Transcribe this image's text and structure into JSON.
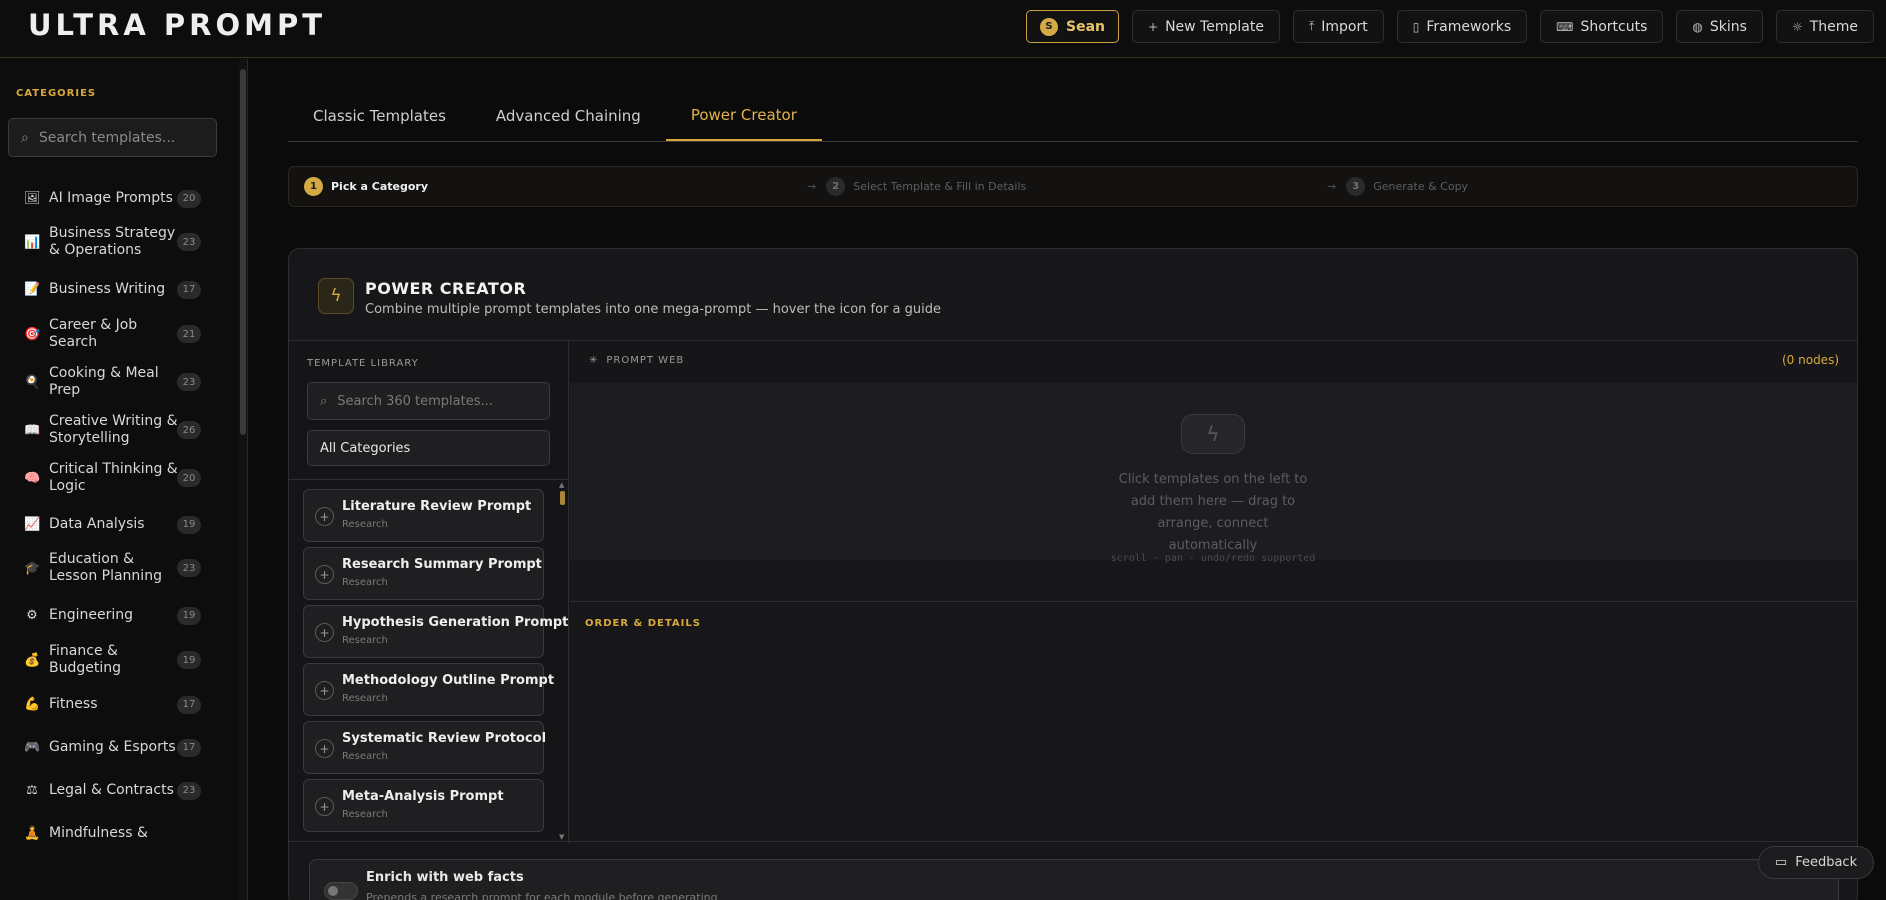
{
  "app": {
    "title": "ULTRA PROMPT"
  },
  "header": {
    "user": {
      "initial": "S",
      "name": "Sean"
    },
    "buttons": [
      {
        "icon": "+",
        "label": "New Template"
      },
      {
        "icon": "⤒",
        "label": "Import"
      },
      {
        "icon": "▯",
        "label": "Frameworks"
      },
      {
        "icon": "⌨",
        "label": "Shortcuts"
      },
      {
        "icon": "◍",
        "label": "Skins"
      },
      {
        "icon": "☼",
        "label": "Theme"
      }
    ]
  },
  "sidebar": {
    "heading": "CATEGORIES",
    "search_placeholder": "Search templates...",
    "items": [
      {
        "icon": "🖼",
        "label": "AI Image Prompts",
        "count": "20"
      },
      {
        "icon": "📊",
        "label": "Business Strategy & Operations",
        "count": "23"
      },
      {
        "icon": "📝",
        "label": "Business Writing",
        "count": "17"
      },
      {
        "icon": "🎯",
        "label": "Career & Job Search",
        "count": "21"
      },
      {
        "icon": "🍳",
        "label": "Cooking & Meal Prep",
        "count": "23"
      },
      {
        "icon": "📖",
        "label": "Creative Writing & Storytelling",
        "count": "26"
      },
      {
        "icon": "🧠",
        "label": "Critical Thinking & Logic",
        "count": "20"
      },
      {
        "icon": "📈",
        "label": "Data Analysis",
        "count": "19"
      },
      {
        "icon": "🎓",
        "label": "Education & Lesson Planning",
        "count": "23"
      },
      {
        "icon": "⚙",
        "label": "Engineering",
        "count": "19"
      },
      {
        "icon": "💰",
        "label": "Finance & Budgeting",
        "count": "19"
      },
      {
        "icon": "💪",
        "label": "Fitness",
        "count": "17"
      },
      {
        "icon": "🎮",
        "label": "Gaming & Esports",
        "count": "17"
      },
      {
        "icon": "⚖",
        "label": "Legal & Contracts",
        "count": "23"
      },
      {
        "icon": "🧘",
        "label": "Mindfulness &",
        "count": ""
      }
    ]
  },
  "tabs": [
    {
      "label": "Classic Templates",
      "active": false
    },
    {
      "label": "Advanced Chaining",
      "active": false
    },
    {
      "label": "Power Creator",
      "active": true
    }
  ],
  "steps": [
    {
      "num": "1",
      "label": "Pick a Category",
      "active": true
    },
    {
      "num": "2",
      "label": "Select Template & Fill in Details",
      "active": false
    },
    {
      "num": "3",
      "label": "Generate & Copy",
      "active": false
    }
  ],
  "power_creator": {
    "title": "POWER CREATOR",
    "subtitle": "Combine multiple prompt templates into one mega-prompt — hover the icon for a guide",
    "library": {
      "heading": "TEMPLATE LIBRARY",
      "search_placeholder": "Search 360 templates...",
      "category_select": "All Categories",
      "templates": [
        {
          "name": "Literature Review Prompt",
          "category": "Research"
        },
        {
          "name": "Research Summary Prompt",
          "category": "Research"
        },
        {
          "name": "Hypothesis Generation Prompt",
          "category": "Research"
        },
        {
          "name": "Methodology Outline Prompt",
          "category": "Research"
        },
        {
          "name": "Systematic Review Protocol",
          "category": "Research"
        },
        {
          "name": "Meta-Analysis Prompt",
          "category": "Research"
        }
      ]
    },
    "web": {
      "title": "PROMPT WEB",
      "nodes": "(0 nodes)",
      "empty_message": "Click templates on the left to add them here — drag to arrange, connect automatically",
      "hint": "scroll · pan · undo/redo supported"
    },
    "order": {
      "title": "ORDER & DETAILS"
    },
    "enrich": {
      "title": "Enrich with web facts",
      "description": "Prepends a research prompt for each module before generating"
    }
  },
  "feedback": {
    "label": "Feedback"
  },
  "colors": {
    "accent": "#d4aa45",
    "background": "#0b0b0b"
  }
}
